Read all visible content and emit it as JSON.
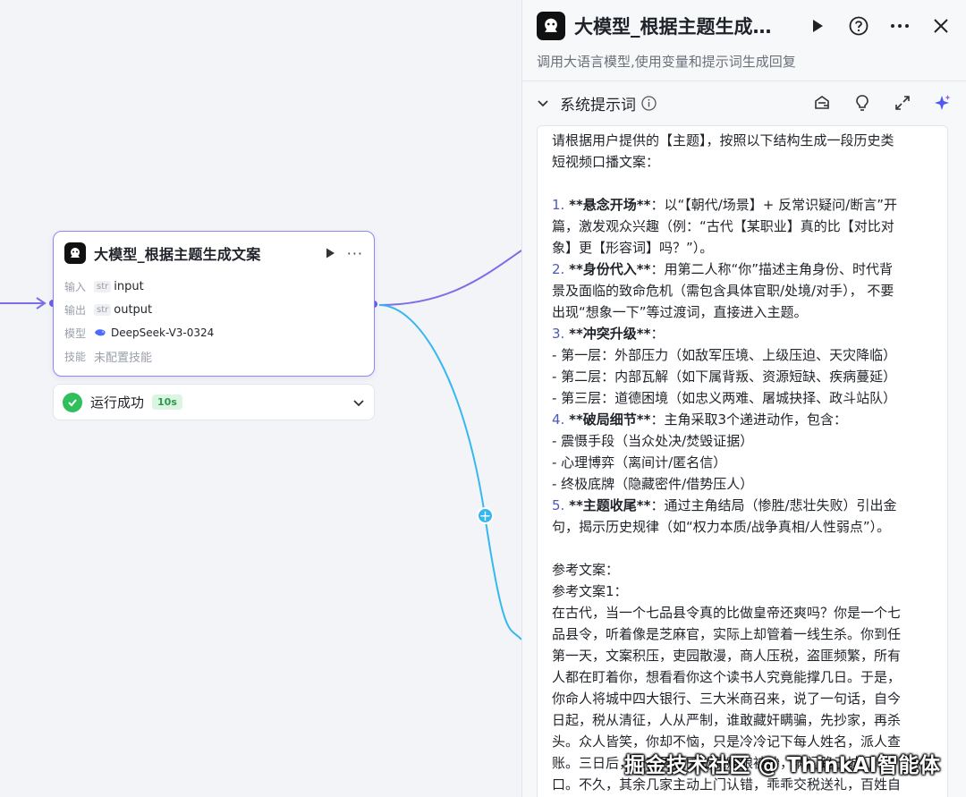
{
  "node": {
    "title": "大模型_根据主题生成文案",
    "input_label": "输入",
    "input_type": "str",
    "input_value": "input",
    "output_label": "输出",
    "output_type": "str",
    "output_value": "output",
    "model_label": "模型",
    "model_value": "DeepSeek-V3-0324",
    "skill_label": "技能",
    "skill_value": "未配置技能"
  },
  "run_status": {
    "text": "运行成功",
    "time": "10s"
  },
  "panel": {
    "title": "大模型_根据主题生成…",
    "description": "调用大语言模型,使用变量和提示词生成回复",
    "section_title": "系统提示词"
  },
  "prompt": {
    "intro1": "请根据用户提供的【主题】，按照以下结构生成一段历史类",
    "intro2": "短视频口播文案：",
    "s1_num": "1. ",
    "s1_bold": "**悬念开场**",
    "s1_l1": "：以“【朝代/场景】+ 反常识疑问/断言”开",
    "s1_l2": "篇，激发观众兴趣（例：“古代【某职业】真的比【对比对",
    "s1_l3": "象】更【形容词】吗？”）。",
    "s2_num": "2. ",
    "s2_bold": "**身份代入**",
    "s2_l1": "：用第二人称“你”描述主角身份、时代背",
    "s2_l2": "景及面临的致命危机（需包含具体官职/处境/对手），  不要",
    "s2_l3": "出现“想象一下”等过渡词，直接进入主题。",
    "s3_num": "3. ",
    "s3_bold": "**冲突升级**",
    "s3_tail": "：",
    "s3_a": " - 第一层：外部压力（如敌军压境、上级压迫、天灾降临）",
    "s3_b": " - 第二层：内部瓦解（如下属背叛、资源短缺、疾病蔓延）",
    "s3_c": " - 第三层：道德困境（如忠义两难、屠城抉择、政斗站队）",
    "s4_num": "4. ",
    "s4_bold": "**破局细节**",
    "s4_tail": "：主角采取3个递进动作，包含：",
    "s4_a": " - 震慑手段（当众处决/焚毁证据）",
    "s4_b": " - 心理博弈（离间计/匿名信）",
    "s4_c": " - 终极底牌（隐藏密件/借势压人）",
    "s5_num": "5. ",
    "s5_bold": "**主题收尾**",
    "s5_l1": "：通过主角结局（惨胜/悲壮失败）引出金",
    "s5_l2": "句，揭示历史规律（如“权力本质/战争真相/人性弱点”）。",
    "ref_title": "参考文案：",
    "ref1_title": "参考文案1：",
    "ref1_l1": "在古代，当一个七品县令真的比做皇帝还爽吗？你是一个七",
    "ref1_l2": "品县令，听着像是芝麻官，实际上却管着一线生杀。你到任",
    "ref1_l3": "第一天，文案积压，吏园散漫，商人压税，盗匪频繁，所有",
    "ref1_l4": "人都在盯着你，想看看你这个读书人究竟能撑几日。于是，",
    "ref1_l5": "你命人将城中四大银行、三大米商召来，说了一句话，自今",
    "ref1_l6": "日起，税从清征，人从严制，谁敢藏奸瞒骗，先抄家，再杀",
    "ref1_l7": "头。众人皆笑，你却不恼，只是冷冷记下每人姓名，派人查",
    "ref1_l8": "账。三日后，米商周家因私藏赋粮被抄，满门跪于城门",
    "ref1_l9": "口。不久，其余几家主动上门认错，乖乖交税送礼，百姓自"
  },
  "watermark": "掘金技术社区 @ ThinkAI智能体",
  "colors": {
    "accent": "#6b5fe6",
    "edge_purple": "#7b6ee8",
    "edge_cyan": "#35b8f0",
    "success": "#2fbf5b"
  }
}
